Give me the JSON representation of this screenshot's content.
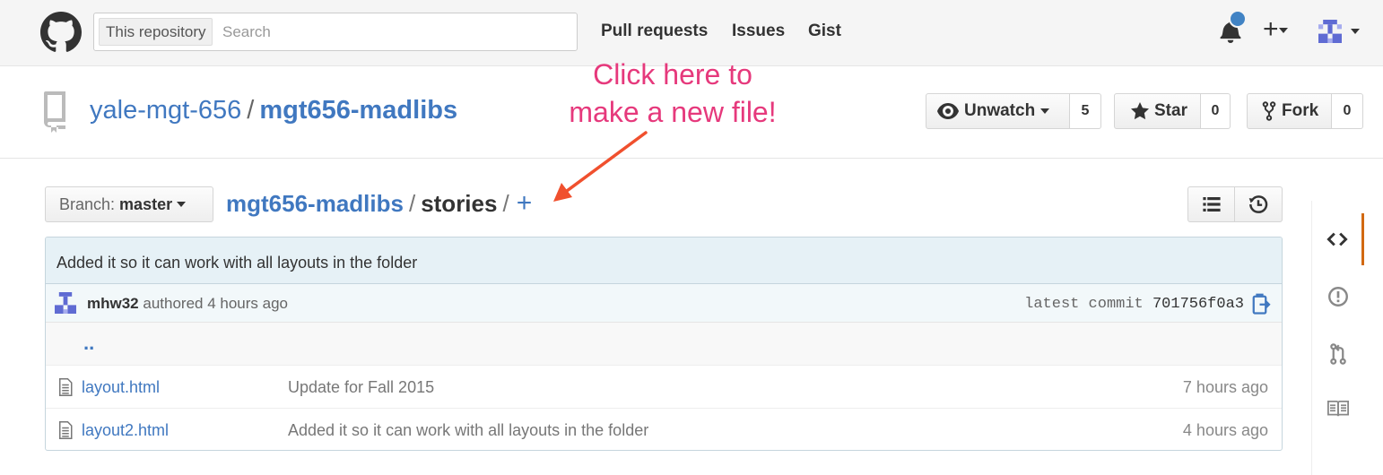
{
  "header": {
    "search_scope": "This repository",
    "search_placeholder": "Search",
    "nav": [
      "Pull requests",
      "Issues",
      "Gist"
    ],
    "plus_label": "+",
    "accent": "#4183c4"
  },
  "repo": {
    "owner": "yale-mgt-656",
    "separator": "/",
    "name": "mgt656-madlibs",
    "watch_label": "Unwatch",
    "watch_count": "5",
    "star_label": "Star",
    "star_count": "0",
    "fork_label": "Fork",
    "fork_count": "0"
  },
  "annotation": {
    "line1": "Click here to",
    "line2": "make a new file!",
    "color": "#e6397c",
    "arrow_color": "#f0502e"
  },
  "file_nav": {
    "branch_prefix": "Branch:",
    "branch_name": "master",
    "root": "mgt656-madlibs",
    "sep": "/",
    "current": "stories",
    "sep2": "/",
    "add_file": "+"
  },
  "commit": {
    "message": "Added it so it can work with all layouts in the folder",
    "author": "mhw32",
    "authored_text": "authored 4 hours ago",
    "latest_label": "latest commit",
    "sha": "701756f0a3"
  },
  "files": {
    "updir": "..",
    "rows": [
      {
        "name": "layout.html",
        "message": "Update for Fall 2015",
        "age": "7 hours ago"
      },
      {
        "name": "layout2.html",
        "message": "Added it so it can work with all layouts in the folder",
        "age": "4 hours ago"
      }
    ]
  },
  "sidebar": {
    "items": [
      "code-icon",
      "issue-icon",
      "pull-request-icon",
      "wiki-icon"
    ],
    "active_color": "#d26911"
  }
}
